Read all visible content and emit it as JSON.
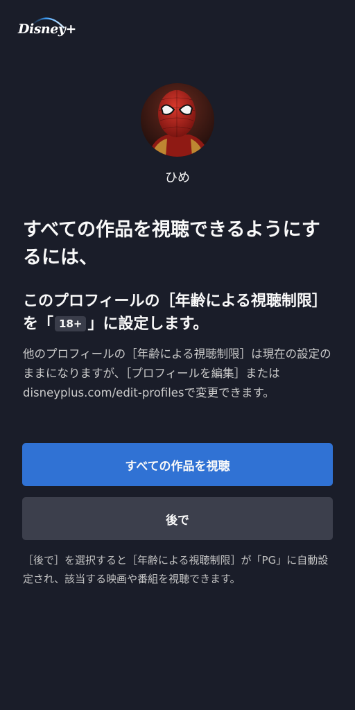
{
  "app": {
    "brand": "Disney+"
  },
  "profile": {
    "name": "ひめ",
    "avatar_icon": "spider-man-avatar"
  },
  "headline": "すべての作品を視聴できるようにするには、",
  "subheading": {
    "before_badge": "このプロフィールの［年齢による視聴制限］を「",
    "badge": "18+",
    "after_badge": "」に設定します。"
  },
  "body": "他のプロフィールの［年齢による視聴制限］は現在の設定のままになりますが、［プロフィールを編集］またはdisneyplus.com/edit-profilesで変更できます。",
  "buttons": {
    "primary": "すべての作品を視聴",
    "secondary": "後で"
  },
  "footnote": "［後で］を選択すると［年齢による視聴制限］が「PG」に自動設定され、該当する映画や番組を視聴できます。",
  "colors": {
    "background": "#1a1d29",
    "primary_button": "#3072d4",
    "secondary_button": "#3c3f4c",
    "text_primary": "#f9f9f9",
    "text_secondary": "#cacaca"
  }
}
